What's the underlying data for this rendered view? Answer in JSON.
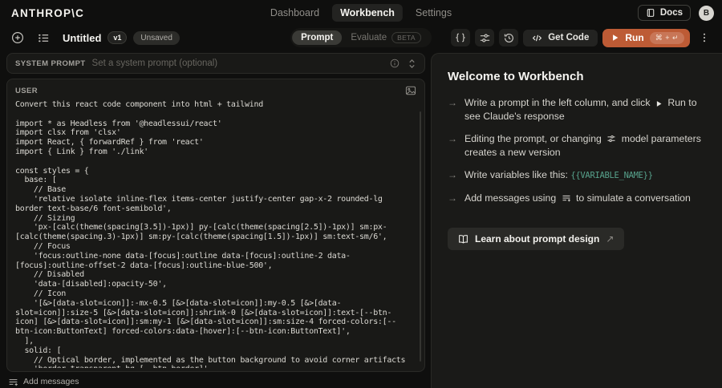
{
  "header": {
    "logo": "ANTHROP\\C",
    "nav": [
      {
        "label": "Dashboard",
        "active": false
      },
      {
        "label": "Workbench",
        "active": true
      },
      {
        "label": "Settings",
        "active": false
      }
    ],
    "docs_label": "Docs",
    "avatar_initial": "B"
  },
  "toolbar": {
    "title": "Untitled",
    "version": "v1",
    "status": "Unsaved",
    "tabs": [
      {
        "label": "Prompt",
        "active": true
      },
      {
        "label": "Evaluate",
        "active": false,
        "badge": "BETA"
      }
    ],
    "get_code_label": "Get Code",
    "run_label": "Run",
    "run_shortcut": "⌘ + ↵"
  },
  "prompt_panel": {
    "system_prompt": {
      "label": "SYSTEM PROMPT",
      "placeholder": "Set a system prompt (optional)"
    },
    "user_message": {
      "role": "USER",
      "content": "Convert this react code component into html + tailwind\n\nimport * as Headless from '@headlessui/react'\nimport clsx from 'clsx'\nimport React, { forwardRef } from 'react'\nimport { Link } from './link'\n\nconst styles = {\n  base: [\n    // Base\n    'relative isolate inline-flex items-center justify-center gap-x-2 rounded-lg border text-base/6 font-semibold',\n    // Sizing\n    'px-[calc(theme(spacing[3.5])-1px)] py-[calc(theme(spacing[2.5])-1px)] sm:px-[calc(theme(spacing.3)-1px)] sm:py-[calc(theme(spacing[1.5])-1px)] sm:text-sm/6',\n    // Focus\n    'focus:outline-none data-[focus]:outline data-[focus]:outline-2 data-[focus]:outline-offset-2 data-[focus]:outline-blue-500',\n    // Disabled\n    'data-[disabled]:opacity-50',\n    // Icon\n    '[&>[data-slot=icon]]:-mx-0.5 [&>[data-slot=icon]]:my-0.5 [&>[data-slot=icon]]:size-5 [&>[data-slot=icon]]:shrink-0 [&>[data-slot=icon]]:text-[--btn-icon] [&>[data-slot=icon]]:sm:my-1 [&>[data-slot=icon]]:sm:size-4 forced-colors:[--btn-icon:ButtonText] forced-colors:data-[hover]:[--btn-icon:ButtonText]',\n  ],\n  solid: [\n    // Optical border, implemented as the button background to avoid corner artifacts\n    'border-transparent bg-[--btn-border]',"
    },
    "add_messages_label": "Add messages"
  },
  "welcome": {
    "title": "Welcome to Workbench",
    "bullets": [
      {
        "before": "Write a prompt in the left column, and click",
        "icon": "play-icon",
        "after": "Run to see Claude's response"
      },
      {
        "before": "Editing the prompt, or changing",
        "icon": "sliders-icon",
        "after": "model parameters creates a new version"
      },
      {
        "before": "Write variables like this:",
        "code": "{{VARIABLE_NAME}}"
      },
      {
        "before": "Add messages using",
        "icon": "add-messages-icon",
        "after": "to simulate a conversation"
      }
    ],
    "learn_button_label": "Learn about prompt design",
    "learn_button_arrow": "↗"
  },
  "colors": {
    "accent": "#bd5b35",
    "variable_code": "#57a28c",
    "page_bg": "#0f0f0e",
    "card_bg": "#191917"
  }
}
